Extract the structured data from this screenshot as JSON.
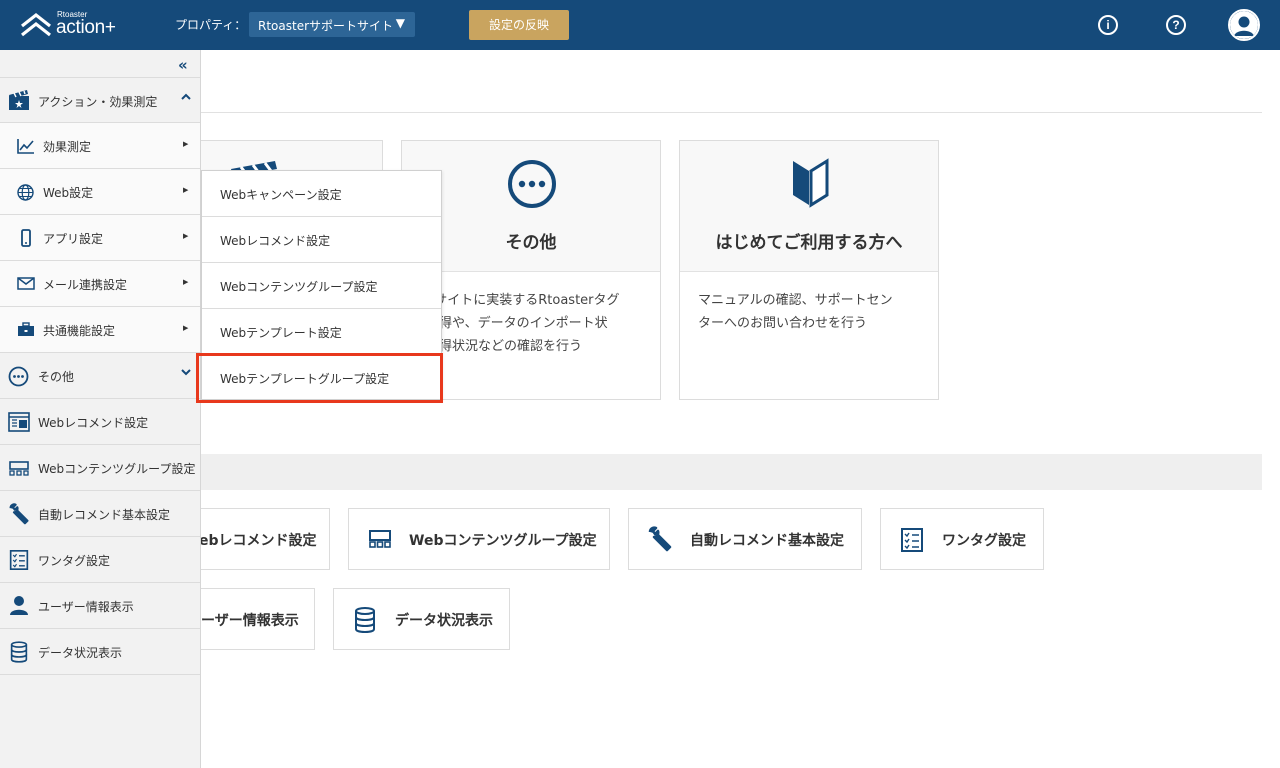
{
  "header": {
    "logo_small": "Rtoaster",
    "logo_big": "action+",
    "property_label": "プロパティ：",
    "property_value": "Rtoasterサポートサイト",
    "apply_button": "設定の反映",
    "info_icon": "info-icon",
    "help_icon": "help-icon",
    "avatar_icon": "user-avatar-icon",
    "colors": {
      "bar": "#154a7a",
      "apply": "#c9a45f"
    }
  },
  "sidebar": {
    "collapse_glyph": "«",
    "sections": [
      {
        "label": "アクション・効果測定",
        "icon": "clapperboard-icon"
      },
      {
        "label": "その他",
        "icon": "more-circle-icon"
      }
    ],
    "action_items": [
      {
        "label": "効果測定",
        "icon": "chart-line-icon"
      },
      {
        "label": "Web設定",
        "icon": "globe-icon"
      },
      {
        "label": "アプリ設定",
        "icon": "smartphone-icon"
      },
      {
        "label": "メール連携設定",
        "icon": "envelope-icon"
      },
      {
        "label": "共通機能設定",
        "icon": "briefcase-icon"
      }
    ],
    "other_items": [
      {
        "label": "Webレコメンド設定",
        "icon": "web-recommend-icon"
      },
      {
        "label": "Webコンテンツグループ設定",
        "icon": "content-group-icon"
      },
      {
        "label": "自動レコメンド基本設定",
        "icon": "wrench-icon"
      },
      {
        "label": "ワンタグ設定",
        "icon": "checklist-icon"
      },
      {
        "label": "ユーザー情報表示",
        "icon": "user-icon"
      },
      {
        "label": "データ状況表示",
        "icon": "database-icon"
      }
    ]
  },
  "submenu": {
    "items": [
      "Webキャンペーン設定",
      "Webレコメンド設定",
      "Webコンテンツグループ設定",
      "Webテンプレート設定",
      "Webテンプレートグループ設定"
    ],
    "highlight_color": "#e8381c"
  },
  "cards": [
    {
      "title": "その他",
      "icon": "more-circle-icon",
      "desc": [
        "bサイトに実装するRtoasterタグ",
        "取得や、データのインポート状",
        "取得状況などの確認を行う"
      ]
    },
    {
      "title": "はじめてご利用する方へ",
      "icon": "beginner-mark-icon",
      "desc": [
        "マニュアルの確認、サポートセン",
        "ターへのお問い合わせを行う"
      ]
    }
  ],
  "tiles": [
    {
      "label": "ebレコメンド設定"
    },
    {
      "label": "Webコンテンツグループ設定",
      "icon": "content-group-icon"
    },
    {
      "label": "自動レコメンド基本設定",
      "icon": "wrench-icon"
    },
    {
      "label": "ワンタグ設定",
      "icon": "checklist-icon"
    },
    {
      "label": "ーザー情報表示"
    },
    {
      "label": "データ状況表示",
      "icon": "database-icon"
    }
  ]
}
